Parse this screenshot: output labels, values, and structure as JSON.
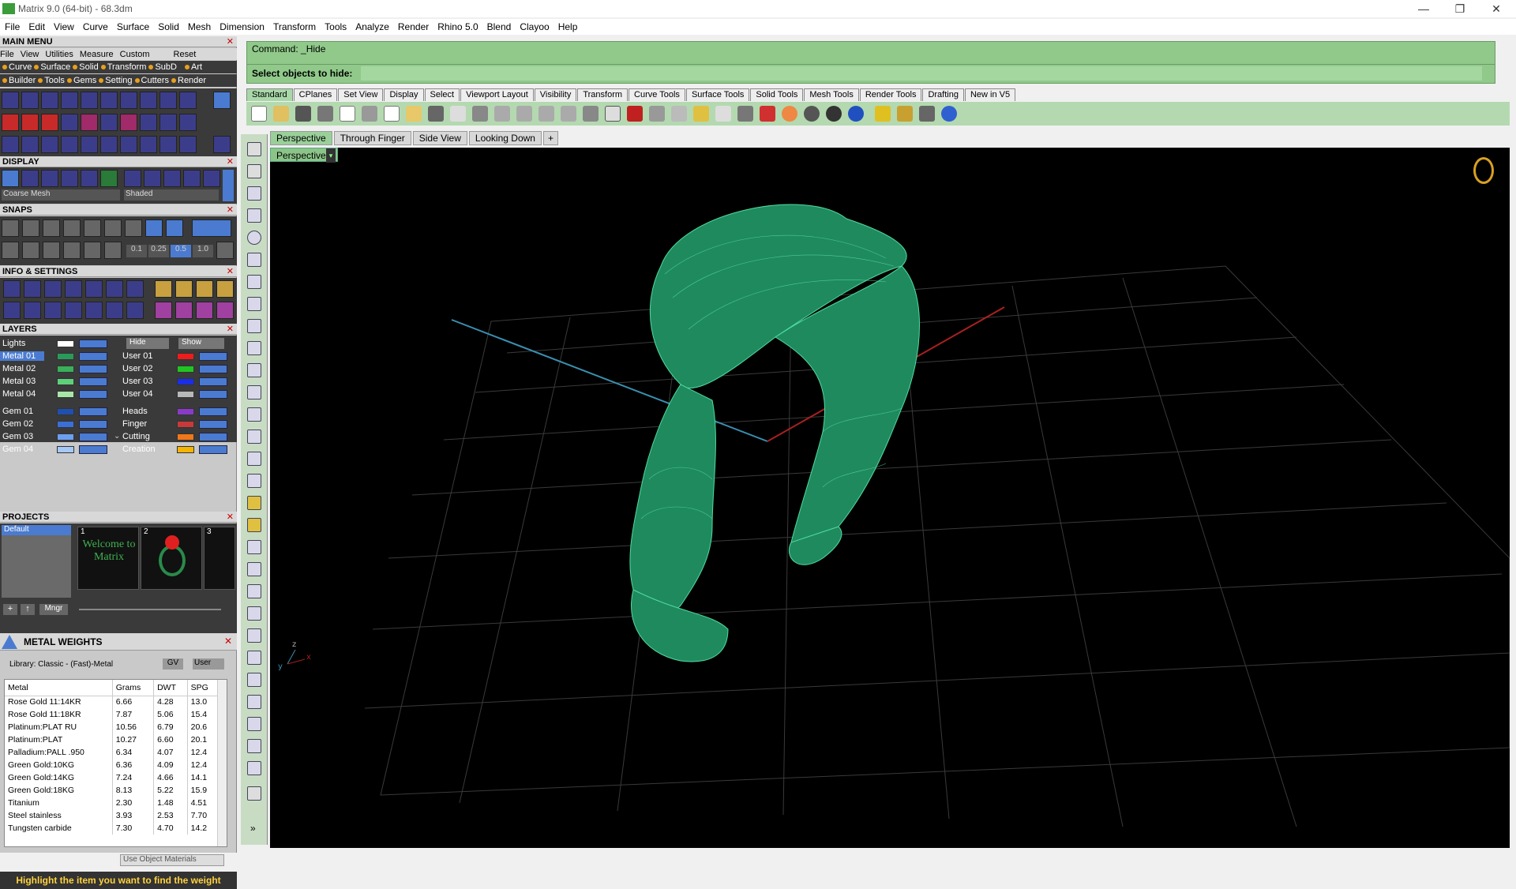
{
  "window": {
    "title": "Matrix 9.0 (64-bit) - 68.3dm",
    "controls": [
      "—",
      "❐",
      "✕"
    ]
  },
  "menu": [
    "File",
    "Edit",
    "View",
    "Curve",
    "Surface",
    "Solid",
    "Mesh",
    "Dimension",
    "Transform",
    "Tools",
    "Analyze",
    "Render",
    "Rhino 5.0",
    "Blend",
    "Clayoo",
    "Help"
  ],
  "main_menu": {
    "title": "MAIN MENU",
    "reset": "Reset",
    "row1": [
      "File",
      "View",
      "Utilities",
      "Measure",
      "Custom"
    ],
    "row2": [
      "Curve",
      "Surface",
      "Solid",
      "Transform",
      "SubD",
      "Art"
    ],
    "row3": [
      "Builder",
      "Tools",
      "Gems",
      "Setting",
      "Cutters",
      "Render"
    ]
  },
  "display": {
    "title": "DISPLAY",
    "mesh_select": "Coarse Mesh",
    "shade_select": "Shaded"
  },
  "snaps": {
    "title": "SNAPS",
    "values": [
      "0.1",
      "0.25",
      "0.5",
      "1.0"
    ]
  },
  "info": {
    "title": "INFO & SETTINGS"
  },
  "layers": {
    "title": "LAYERS",
    "lights": "Lights",
    "hide": "Hide",
    "show": "Show",
    "left": [
      {
        "name": "Metal 01",
        "color": "#2a9a5a",
        "selected": true
      },
      {
        "name": "Metal 02",
        "color": "#39b05a"
      },
      {
        "name": "Metal 03",
        "color": "#5fd07a"
      },
      {
        "name": "Metal 04",
        "color": "#a8e6a8"
      },
      {
        "name": "Gem 01",
        "color": "#1f4fb0"
      },
      {
        "name": "Gem 02",
        "color": "#3a6fd8"
      },
      {
        "name": "Gem 03",
        "color": "#6d9ff0"
      },
      {
        "name": "Gem 04",
        "color": "#a6c8f5"
      }
    ],
    "right": [
      {
        "name": "User 01",
        "color": "#ee1c1c"
      },
      {
        "name": "User 02",
        "color": "#22c422"
      },
      {
        "name": "User 03",
        "color": "#1a2ee8"
      },
      {
        "name": "User 04",
        "color": "#b8b8b8"
      },
      {
        "name": "Heads",
        "color": "#8a3ac8"
      },
      {
        "name": "Finger",
        "color": "#c83a3a"
      },
      {
        "name": "Cutting",
        "color": "#f07818"
      },
      {
        "name": "Creation",
        "color": "#f5b400"
      }
    ]
  },
  "projects": {
    "title": "PROJECTS",
    "list": [
      "Default"
    ],
    "thumbs": [
      {
        "n": "1",
        "label": "Welcome to Matrix"
      },
      {
        "n": "2",
        "label": ""
      },
      {
        "n": "3",
        "label": ""
      }
    ],
    "mngr": "Mngr"
  },
  "metal_weights": {
    "title": "METAL WEIGHTS",
    "library": "Library: Classic - (Fast)-Metal",
    "gv": "GV",
    "user": "User",
    "headers": [
      "Metal",
      "Grams",
      "DWT",
      "SPG"
    ],
    "rows": [
      [
        "Rose Gold 11:14KR",
        "6.66",
        "4.28",
        "13.0"
      ],
      [
        "Rose Gold 11:18KR",
        "7.87",
        "5.06",
        "15.4"
      ],
      [
        "Platinum:PLAT RU",
        "10.56",
        "6.79",
        "20.6"
      ],
      [
        "Platinum:PLAT",
        "10.27",
        "6.60",
        "20.1"
      ],
      [
        "Palladium:PALL .950",
        "6.34",
        "4.07",
        "12.4"
      ],
      [
        "Green Gold:10KG",
        "6.36",
        "4.09",
        "12.4"
      ],
      [
        "Green Gold:14KG",
        "7.24",
        "4.66",
        "14.1"
      ],
      [
        "Green Gold:18KG",
        "8.13",
        "5.22",
        "15.9"
      ],
      [
        "Titanium",
        "2.30",
        "1.48",
        "4.51"
      ],
      [
        "Steel stainless",
        "3.93",
        "2.53",
        "7.70"
      ],
      [
        "Tungsten carbide",
        "7.30",
        "4.70",
        "14.2"
      ]
    ],
    "use_object_materials": "Use Object Materials",
    "hint": "Highlight the item you want to find the weight"
  },
  "command": {
    "line1": "Command: _Hide",
    "line2": "Select objects to hide:"
  },
  "toolbar_tabs": [
    "Standard",
    "CPlanes",
    "Set View",
    "Display",
    "Select",
    "Viewport Layout",
    "Visibility",
    "Transform",
    "Curve Tools",
    "Surface Tools",
    "Solid Tools",
    "Mesh Tools",
    "Render Tools",
    "Drafting",
    "New in V5"
  ],
  "viewport_tabs": [
    "Perspective",
    "Through Finger",
    "Side View",
    "Looking Down"
  ],
  "viewport": {
    "name": "Perspective",
    "axis_z": "z",
    "axis_x": "x",
    "axis_y": "y"
  }
}
